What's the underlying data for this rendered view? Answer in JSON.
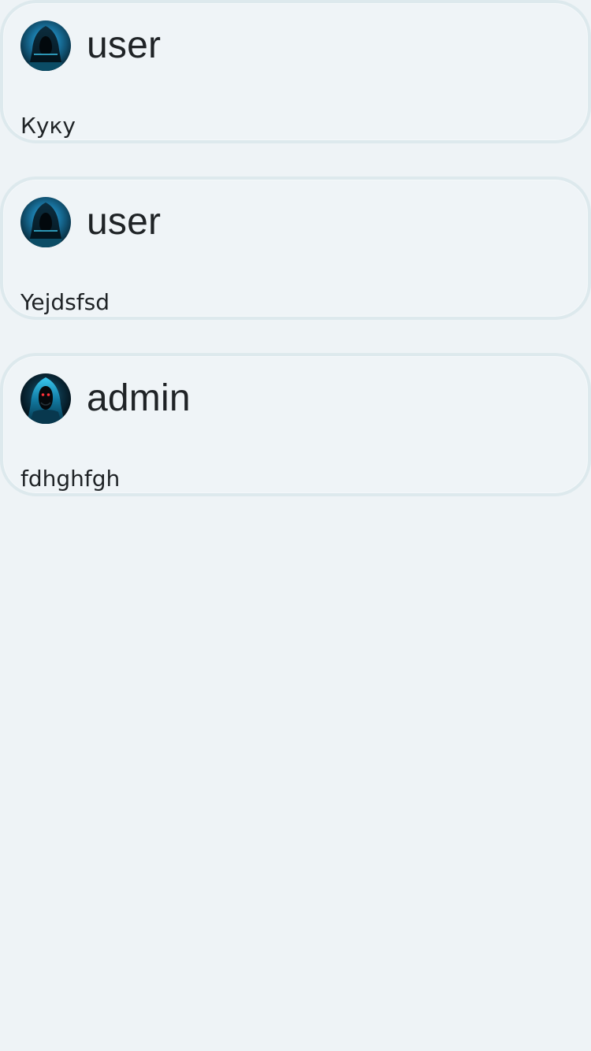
{
  "posts": [
    {
      "author": "user",
      "avatar_icon": "hooded-hacker-laptop-icon",
      "text": "Куку"
    },
    {
      "author": "user",
      "avatar_icon": "hooded-hacker-laptop-icon",
      "text": "Yejdsfsd"
    },
    {
      "author": "admin",
      "avatar_icon": "hooded-hacker-red-eyes-icon",
      "text": "fdhghfgh"
    }
  ],
  "colors": {
    "background": "#eef3f6",
    "card_border": "#dde9ed",
    "text": "#1f2326",
    "avatar_accent": "#1f8fb8",
    "eye_red": "#ff3038"
  }
}
